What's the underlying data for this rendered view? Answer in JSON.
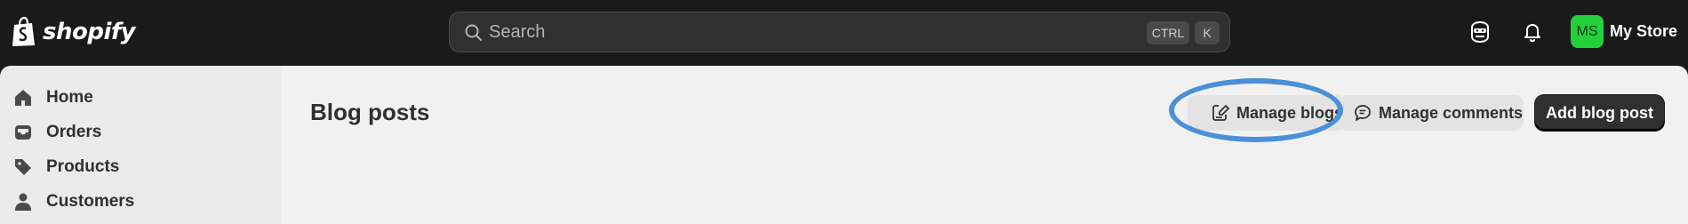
{
  "topbar": {
    "brand": "shopify",
    "search_placeholder": "Search",
    "shortcut_ctrl": "CTRL",
    "shortcut_k": "K",
    "avatar_initials": "MS",
    "store_name": "My Store",
    "avatar_color": "#22d13a"
  },
  "sidebar": {
    "items": [
      {
        "label": "Home",
        "icon": "home-icon"
      },
      {
        "label": "Orders",
        "icon": "inbox-icon"
      },
      {
        "label": "Products",
        "icon": "tag-icon"
      },
      {
        "label": "Customers",
        "icon": "person-icon"
      }
    ]
  },
  "main": {
    "title": "Blog posts",
    "buttons": {
      "manage_blogs": "Manage blogs",
      "manage_comments": "Manage comments",
      "add_blog_post": "Add blog post"
    }
  },
  "annotation": {
    "highlight_color": "#4a90d9"
  }
}
